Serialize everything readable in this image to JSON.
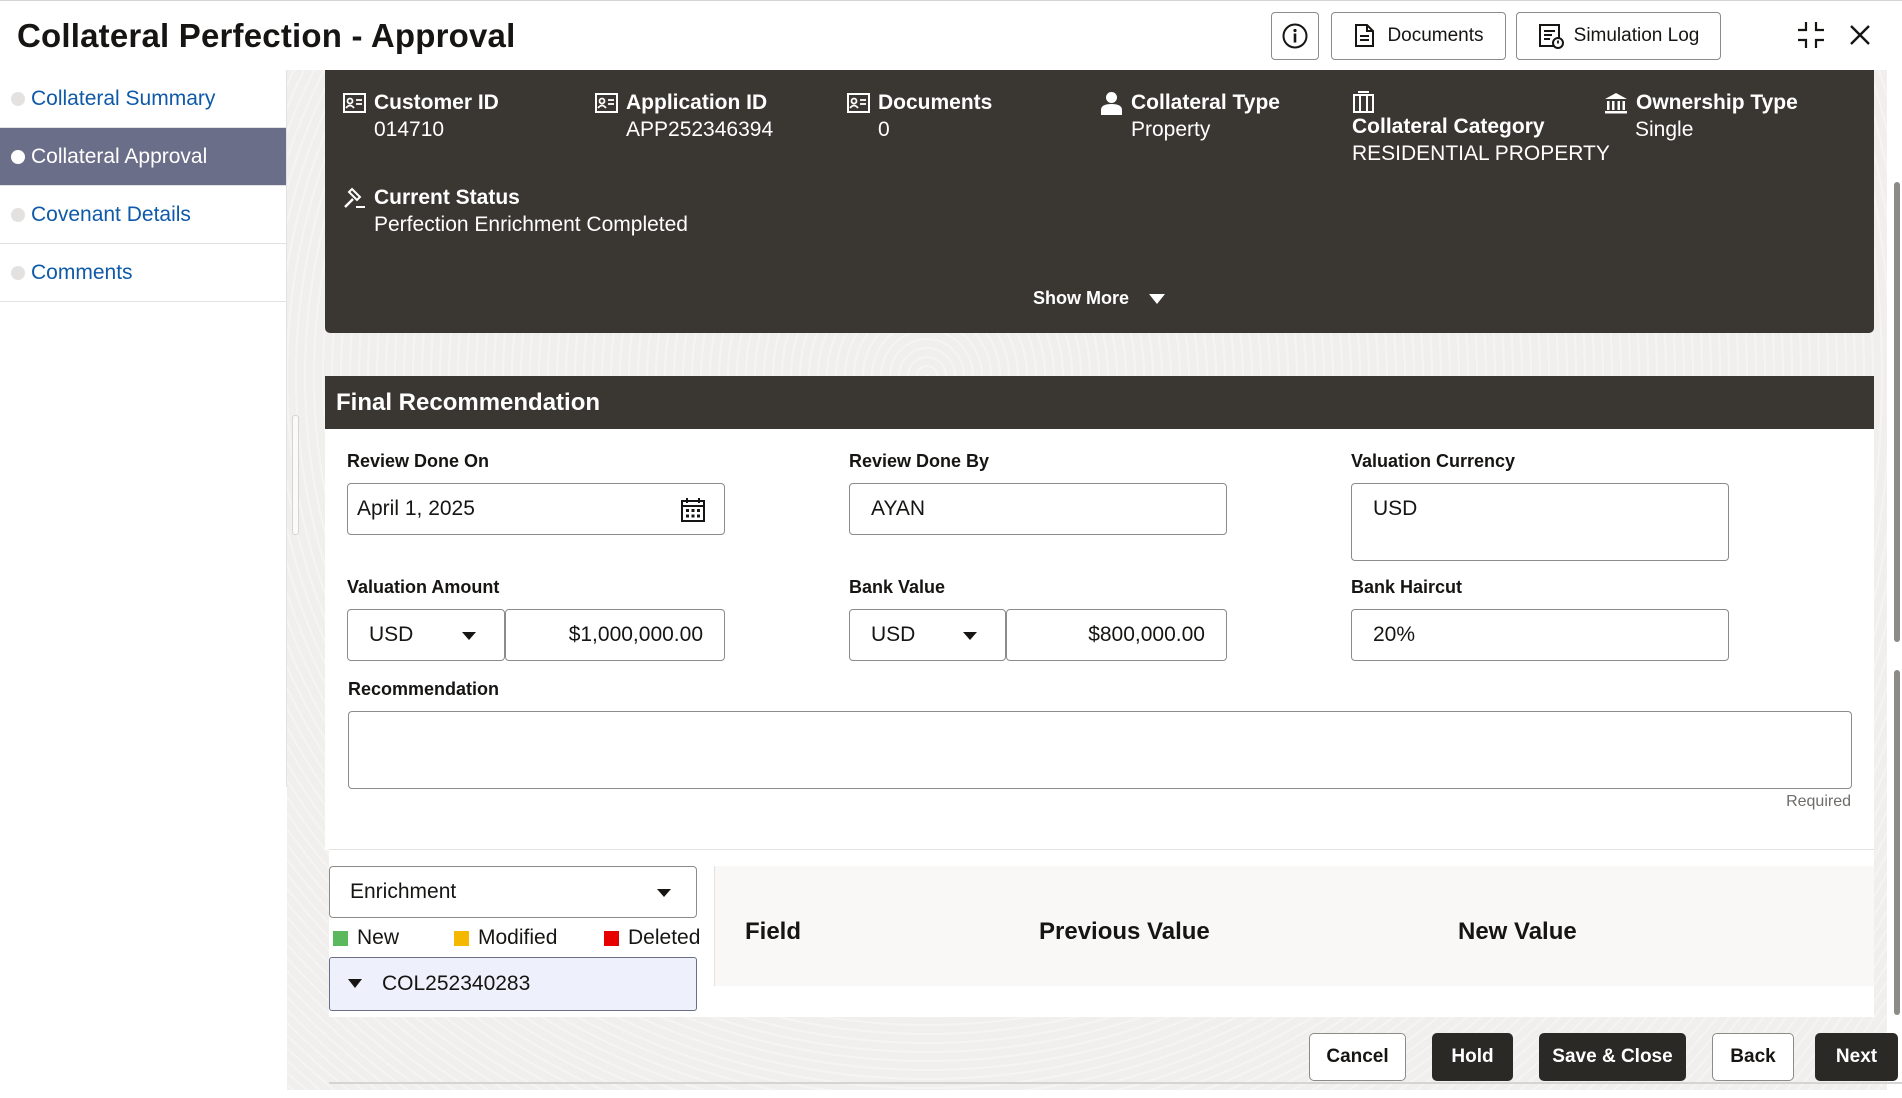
{
  "header": {
    "title": "Collateral Perfection - Approval",
    "documents_label": "Documents",
    "simulation_log_label": "Simulation Log"
  },
  "nav": {
    "items": [
      {
        "label": "Collateral Summary"
      },
      {
        "label": "Collateral Approval"
      },
      {
        "label": "Covenant Details"
      },
      {
        "label": "Comments"
      }
    ]
  },
  "info": {
    "customer_id": {
      "label": "Customer ID",
      "value": "014710"
    },
    "application_id": {
      "label": "Application ID",
      "value": "APP252346394"
    },
    "documents": {
      "label": "Documents",
      "value": "0"
    },
    "collateral_type": {
      "label": "Collateral Type",
      "value": "Property"
    },
    "collateral_category": {
      "label": "Collateral Category",
      "value": "RESIDENTIAL PROPERTY"
    },
    "ownership_type": {
      "label": "Ownership Type",
      "value": "Single"
    },
    "current_status": {
      "label": "Current Status",
      "value": "Perfection Enrichment Completed"
    },
    "show_more": "Show More"
  },
  "final_recommendation": {
    "title": "Final Recommendation",
    "review_done_on": {
      "label": "Review Done On",
      "value": "April 1, 2025"
    },
    "review_done_by": {
      "label": "Review Done By",
      "value": "AYAN"
    },
    "valuation_currency": {
      "label": "Valuation Currency",
      "value": "USD"
    },
    "valuation_amount": {
      "label": "Valuation Amount",
      "currency": "USD",
      "value": "$1,000,000.00"
    },
    "bank_value": {
      "label": "Bank Value",
      "currency": "USD",
      "value": "$800,000.00"
    },
    "bank_haircut": {
      "label": "Bank Haircut",
      "value": "20%"
    },
    "recommendation": {
      "label": "Recommendation",
      "value": "",
      "helper": "Required"
    }
  },
  "enrichment": {
    "selected": "Enrichment",
    "legend": [
      {
        "label": "New",
        "color": "#5cb85c"
      },
      {
        "label": "Modified",
        "color": "#f5b800"
      },
      {
        "label": "Deleted",
        "color": "#e60000"
      }
    ],
    "tree_node": "COL252340283",
    "columns": [
      "Field",
      "Previous Value",
      "New Value"
    ]
  },
  "footer": {
    "cancel": "Cancel",
    "hold": "Hold",
    "save_close": "Save & Close",
    "back": "Back",
    "next": "Next"
  },
  "colors": {
    "header_dark": "#3a3631",
    "nav_active": "#6b6e89",
    "link_blue": "#0f5aa8"
  }
}
